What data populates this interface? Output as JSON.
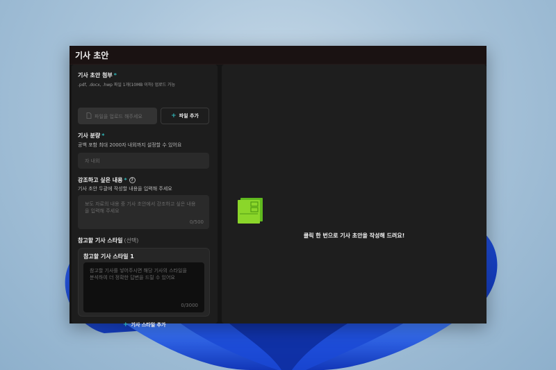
{
  "window": {
    "title": "기사 초안"
  },
  "left_panel": {
    "attach": {
      "label": "기사 초안 첨부",
      "required_mark": "*",
      "hint": ".pdf, .docx, .hwp 파일 1개(10MB 이하) 업로드 가능",
      "placeholder": "파일을 업로드 해주세요",
      "add_file_label": "파일 추가"
    },
    "length": {
      "label": "기사 분량",
      "required_mark": "*",
      "hint": "공백 포함 최대 2000자 내외까지 설정할 수 있어요",
      "placeholder": "자 내외"
    },
    "emphasis": {
      "label": "강조하고 싶은 내용",
      "required_mark": "*",
      "help_icon": "question-circle",
      "hint": "기사 초안 두괄에 작성할 내용을 입력해 주세요",
      "placeholder_line1": "보도 자료의 내용 중 기사 초안에서 강조하고 싶은 내용",
      "placeholder_line2": "을 입력해 주세요",
      "counter": "0/500"
    },
    "reference_style": {
      "label": "참고할 기사 스타일",
      "optional_note": "(선택)",
      "card_title": "참고할 기사 스타일 1",
      "placeholder_line1": "참고할 기사를 넣어주시면 해당 기사의 스타일을",
      "placeholder_line2": "분석하여 더 정확한 답변을 드릴 수 있어요",
      "counter": "0/3000",
      "add_label": "기사 스타일 추가"
    }
  },
  "right_panel": {
    "empty_icon": "green-document-icon",
    "empty_message": "클릭 한 번으로 기사 초안을 작성해 드려요!"
  },
  "colors": {
    "accent": "#2fb6b8",
    "panel_bg": "#1d1d1d",
    "field_bg": "#2a2a2a",
    "icon_green": "#7ed321"
  }
}
